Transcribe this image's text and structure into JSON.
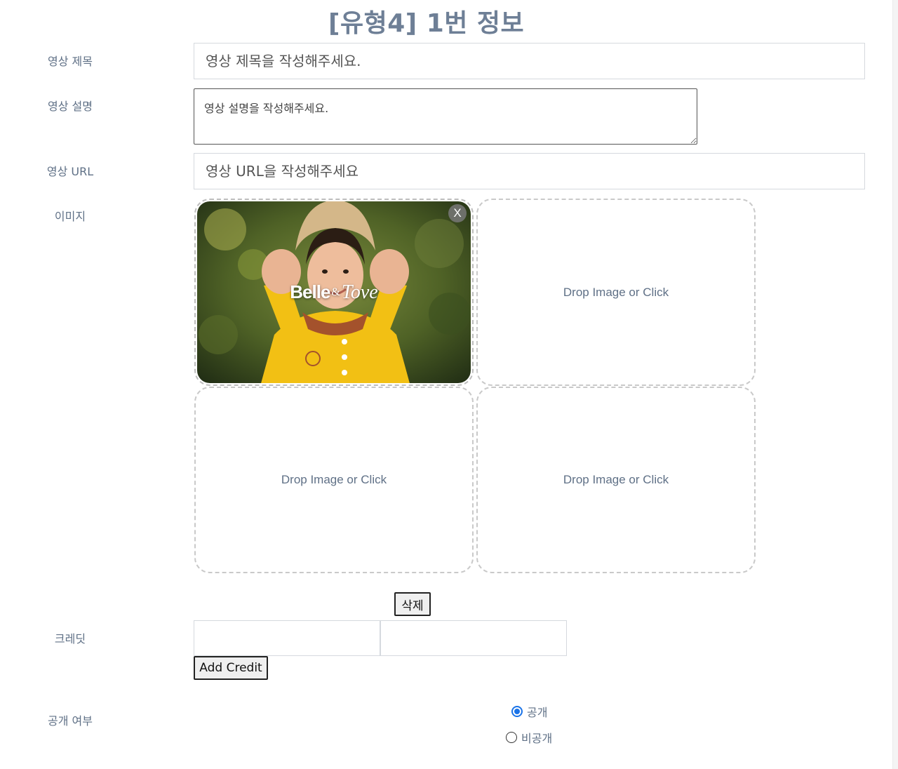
{
  "page": {
    "title": "[유형4] 1번 정보"
  },
  "form": {
    "title_label": "영상 제목",
    "title_placeholder": "영상 제목을 작성해주세요.",
    "description_label": "영상 설명",
    "description_placeholder": "영상 설명을 작성해주세요.",
    "url_label": "영상 URL",
    "url_placeholder": "영상 URL을 작성해주세요",
    "image_label": "이미지",
    "credit_label": "크레딧",
    "visibility_label": "공개 여부"
  },
  "images": {
    "slot1": {
      "filled": true,
      "logo_main": "Belle",
      "logo_amp": "&",
      "logo_second": "Tove",
      "remove_label": "X"
    },
    "slot2": {
      "text": "Drop Image or Click"
    },
    "slot3": {
      "text": "Drop Image or Click"
    },
    "slot4": {
      "text": "Drop Image or Click"
    },
    "delete_label": "삭제"
  },
  "credit": {
    "name_value": "",
    "role_value": "",
    "add_label": "Add Credit"
  },
  "visibility": {
    "options": [
      {
        "label": "공개",
        "checked": true
      },
      {
        "label": "비공개",
        "checked": false
      }
    ]
  },
  "colors": {
    "accent": "#1a73e8",
    "label_text": "#5f7086",
    "title_text": "#6e7f96",
    "dashed_border": "#c9c9c9"
  }
}
